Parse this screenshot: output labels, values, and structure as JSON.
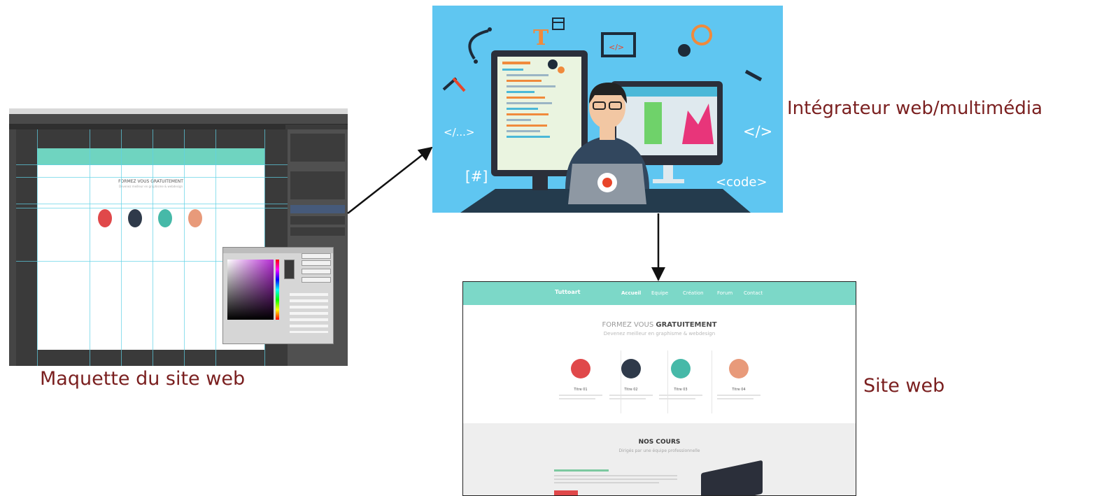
{
  "captions": {
    "mockup": "Maquette du site web",
    "integrator": "Intégrateur web/multimédia",
    "website": "Site web"
  },
  "illustration": {
    "symbols": [
      "</...>",
      "[#]",
      "</>",
      "<code>"
    ]
  },
  "site": {
    "logo": "Tuttoart",
    "nav": [
      "Accueil",
      "Equipe",
      "Création",
      "Forum",
      "Contact"
    ],
    "tagline_light": "FORMEZ VOUS",
    "tagline_bold": "GRATUITEMENT",
    "subtagline": "Devenez meilleur en graphisme & webdesign",
    "features": [
      "Titre 01",
      "Titre 02",
      "Titre 03",
      "Titre 04"
    ],
    "section_title": "NOS COURS",
    "section_sub": "Dirigés par une équipe professionnelle"
  },
  "mockup": {
    "tagline": "FORMEZ VOUS GRATUITEMENT",
    "subtagline": "Devenez meilleur en graphisme & webdesign"
  },
  "colors": {
    "caption": "#7a1f1f",
    "teal": "#7cd8c8",
    "sky": "#5fc6f1",
    "feature_1": "#e0484a",
    "feature_2": "#2f3a4a",
    "feature_3": "#46b9a8",
    "feature_4": "#e89a7a"
  }
}
